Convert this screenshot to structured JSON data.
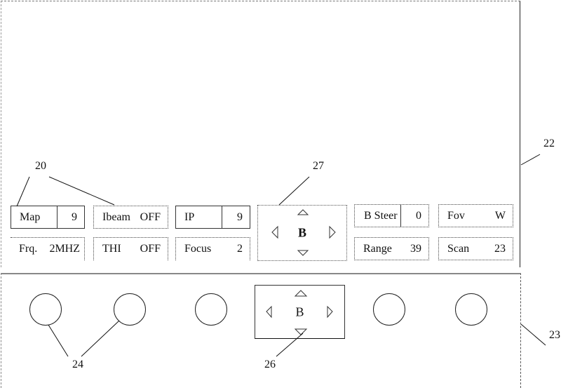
{
  "screen": {
    "row1": [
      {
        "label": "Map",
        "value": "9"
      },
      {
        "label": "Ibeam",
        "value": "OFF"
      },
      {
        "label": "IP",
        "value": "9"
      },
      {
        "label": "B Steer",
        "value": "0"
      },
      {
        "label": "Fov",
        "value": "W"
      }
    ],
    "row2": [
      {
        "label": "Frq.",
        "value": "2MHZ"
      },
      {
        "label": "THI",
        "value": "OFF"
      },
      {
        "label": "Focus",
        "value": "2"
      },
      {
        "label": "Range",
        "value": "39"
      },
      {
        "label": "Scan",
        "value": "23"
      }
    ],
    "dpad": {
      "center": "B",
      "up_icon": "triangle-up",
      "down_icon": "triangle-down",
      "left_icon": "triangle-left",
      "right_icon": "triangle-right"
    }
  },
  "panel": {
    "dpad": {
      "center": "B"
    },
    "knob_count": 5
  },
  "callouts": {
    "c20": "20",
    "c22": "22",
    "c23": "23",
    "c24": "24",
    "c26": "26",
    "c27": "27"
  }
}
